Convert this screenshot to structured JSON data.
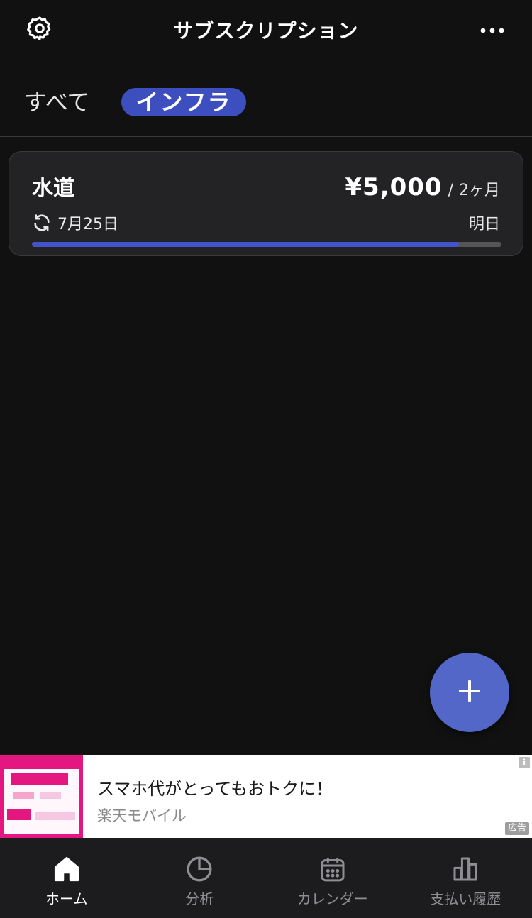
{
  "header": {
    "title": "サブスクリプション",
    "settings_icon": "gear-icon",
    "more_icon": "more-dots-icon"
  },
  "tabs": [
    {
      "label": "すべて",
      "active": false
    },
    {
      "label": "インフラ",
      "active": true
    }
  ],
  "subscriptions": [
    {
      "name": "水道",
      "price": "¥5,000",
      "separator": "/",
      "period": "2ヶ月",
      "renew_date": "7月25日",
      "due_label": "明日",
      "progress": 0.91
    }
  ],
  "fab": {
    "icon": "plus-icon"
  },
  "ad": {
    "title": "スマホ代がとってもおトクに！",
    "advertiser": "楽天モバイル",
    "badge": "広告",
    "info": "i"
  },
  "nav": [
    {
      "label": "ホーム",
      "icon": "home-icon",
      "active": true
    },
    {
      "label": "分析",
      "icon": "pie-chart-icon",
      "active": false
    },
    {
      "label": "カレンダー",
      "icon": "calendar-icon",
      "active": false
    },
    {
      "label": "支払い履歴",
      "icon": "bar-chart-icon",
      "active": false
    }
  ],
  "colors": {
    "background": "#111112",
    "accent": "#3d4fbf",
    "fab": "#5367c8",
    "card": "#232325"
  }
}
